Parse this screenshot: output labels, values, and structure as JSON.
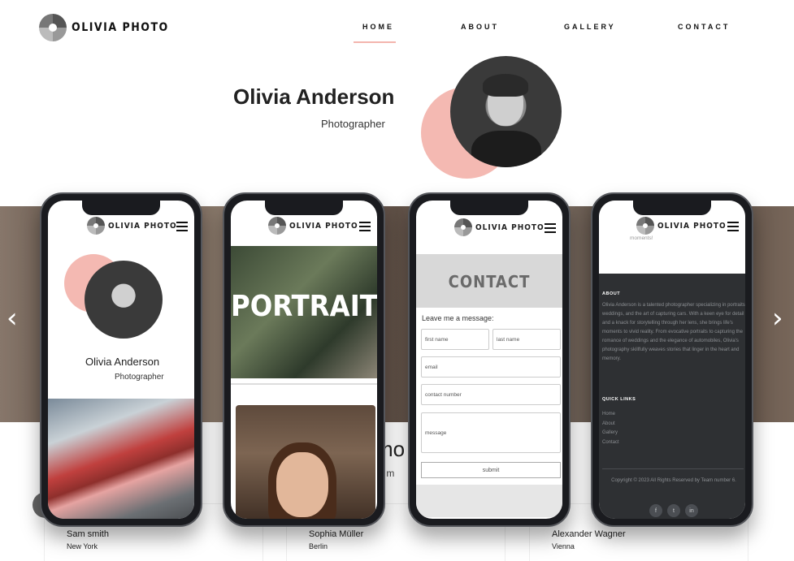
{
  "brand": {
    "name": "OLIVIA PHOTO"
  },
  "nav": {
    "items": [
      {
        "label": "HOME"
      },
      {
        "label": "ABOUT"
      },
      {
        "label": "GALLERY"
      },
      {
        "label": "CONTACT"
      }
    ]
  },
  "hero": {
    "name": "Olivia Anderson",
    "role": "Photographer"
  },
  "carousel": {
    "prev_icon": "chevron-left-icon",
    "next_icon": "chevron-right-icon"
  },
  "testimonials": {
    "heading": "mo",
    "sub": "at m",
    "items": [
      {
        "name": "Sam smith",
        "city": "New York"
      },
      {
        "name": "Sophia Müller",
        "city": "Berlin"
      },
      {
        "name": "Alexander Wagner",
        "city": "Vienna"
      }
    ]
  },
  "phones": {
    "p1": {
      "name": "Olivia Anderson",
      "role": "Photographer"
    },
    "p2": {
      "title": "PORTRAITS"
    },
    "p3": {
      "title": "CONTACT",
      "leave": "Leave me a message:",
      "first": "first name",
      "last": "last name",
      "email": "email",
      "contact": "contact number",
      "message": "message",
      "submit": "submit"
    },
    "p4": {
      "ghost": "moments!",
      "about_h": "ABOUT",
      "about": "Olivia Anderson is a talented photographer specializing in portraits, weddings, and the art of capturing cars. With a keen eye for detail and a knack for storytelling through her lens, she brings life's moments to vivid reality. From evocative portraits to capturing the romance of weddings and the elegance of automobiles, Olivia's photography skillfully weaves stories that linger in the heart and memory.",
      "links_h": "QUICK LINKS",
      "links": [
        "Home",
        "About",
        "Gallery",
        "Contact"
      ],
      "copy": "Copyright © 2023 All Rights Reserved by Team number 6.",
      "social": [
        "facebook-icon",
        "twitter-icon",
        "linkedin-icon"
      ]
    }
  },
  "colors": {
    "accent": "#f4b9b2",
    "footer": "#2e3033"
  }
}
